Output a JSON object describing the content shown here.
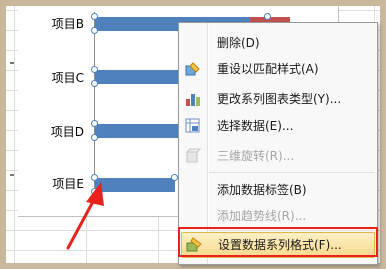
{
  "chart": {
    "categories": [
      "项目B",
      "项目C",
      "项目D",
      "项目E"
    ],
    "series_color": "#4f81bd",
    "second_series_color": "#c0504d"
  },
  "menu": {
    "items": [
      {
        "label": "删除(D)",
        "icon": "delete",
        "enabled": true
      },
      {
        "label": "重设以匹配样式(A)",
        "icon": "reset-style-icon",
        "enabled": true
      },
      {
        "label": "更改系列图表类型(Y)...",
        "icon": "bar-chart-icon",
        "enabled": true
      },
      {
        "label": "选择数据(E)...",
        "icon": "select-data-icon",
        "enabled": true
      },
      {
        "label": "三维旋转(R)...",
        "icon": "3d-rotation-icon",
        "enabled": false
      },
      {
        "label": "添加数据标签(B)",
        "icon": "",
        "enabled": true
      },
      {
        "label": "添加趋势线(R)...",
        "icon": "",
        "enabled": false
      },
      {
        "label": "设置数据系列格式(F)...",
        "icon": "format-series-icon",
        "enabled": true
      }
    ],
    "highlight_color": "#f9d98a"
  },
  "annotation": {
    "color": "#e8231e"
  }
}
